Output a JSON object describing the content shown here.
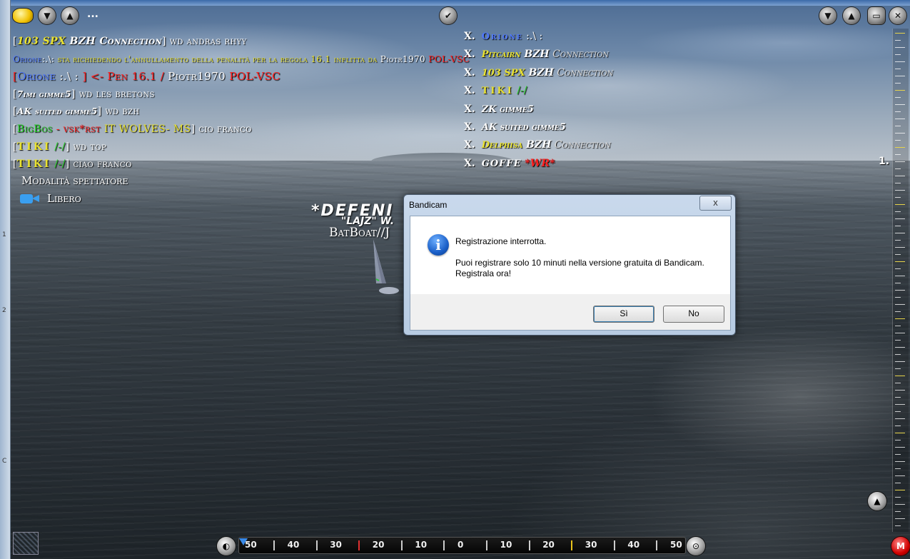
{
  "toolbar": {
    "more_label": "..."
  },
  "chat": [
    [
      "[",
      "103 SPX",
      " BZH",
      " Connection",
      "]",
      " wd andras rhyy"
    ],
    [
      "Orione",
      ":.\\:",
      " sta richiedendo l'annullamento della penalità per la regola 16.1 inflitta da",
      " Piotr1970",
      " POL-VSC"
    ],
    [
      "[",
      "Orione",
      " :.\\ : ",
      "]",
      " <- Pen 16.1 /",
      " Piotr1970",
      " POL-VSC"
    ],
    [
      "[",
      "7imi gimme5",
      "]",
      " wd les bretons"
    ],
    [
      "[",
      "AK suited gimme5",
      "]",
      " wd bzh"
    ],
    [
      "[",
      "BigBos",
      " - vsk*rst",
      "  IT WOLVES- MS",
      "]",
      " cio franco"
    ],
    [
      "[",
      "TIKI",
      " /-/",
      "]",
      " wd top"
    ],
    [
      "[",
      "TIKI",
      " /-/",
      "]",
      " ciao franco"
    ]
  ],
  "spectator": {
    "mode_label": "Modalità spettatore",
    "camera_label": "Libero"
  },
  "leaderboard": [
    {
      "x": "X.",
      "name": "Orione",
      "suffix": " :.\\ :"
    },
    {
      "x": "X.",
      "name": "Pitcairn",
      "suffix": " BZH",
      "team": " Connection"
    },
    {
      "x": "X.",
      "name": "103 SPX",
      "suffix": " BZH",
      "team": " Connection"
    },
    {
      "x": "X.",
      "name": "TIKI",
      "suffix": " /-/"
    },
    {
      "x": "X.",
      "name": "ZK gimme5",
      "suffix": ""
    },
    {
      "x": "X.",
      "name": "AK suited gimme5",
      "suffix": ""
    },
    {
      "x": "X.",
      "name": "Delphisa",
      "suffix": " BZH",
      "team": " Connection"
    },
    {
      "x": "X.",
      "name": "GOFFE",
      "suffix": " *WR*"
    }
  ],
  "rank_marker": "1.",
  "boat_labels": {
    "line1": "*DEFENI",
    "line2": "\"LAJZ\" W.",
    "line3": "BatBoat//J"
  },
  "compass": {
    "ticks": [
      "50",
      "40",
      "30",
      "20",
      "10",
      "0",
      "10",
      "20",
      "30",
      "40",
      "50"
    ],
    "red_button_label": "M"
  },
  "dialog": {
    "title": "Bandicam",
    "close_label": "x",
    "message_title": "Registrazione interrotta.",
    "message_body_1": "Puoi registrare solo 10 minuti nella versione gratuita di Bandicam.",
    "message_body_2": "Registrala ora!",
    "yes_label": "Sì",
    "no_label": "No"
  },
  "left_frame_marks": [
    "1",
    "2",
    "C"
  ]
}
